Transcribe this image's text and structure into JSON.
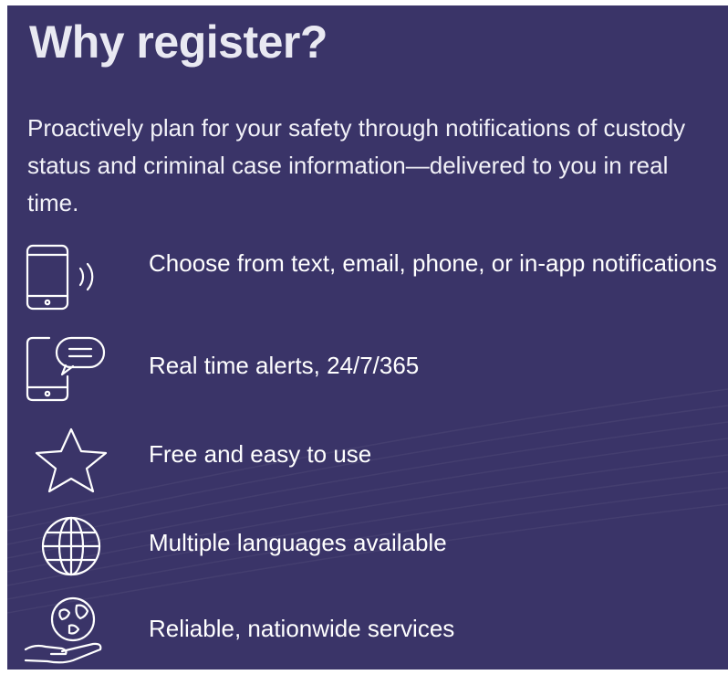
{
  "panel": {
    "title": "Why register?",
    "intro": "Proactively plan for your safety through notifications of custody status and criminal case information—delivered to you in real time.",
    "background_color": "#3a3468",
    "text_color": "#ffffff"
  },
  "features": [
    {
      "icon": "mobile-phone-signal-icon",
      "label": "Choose from text, email, phone, or in-app notifications"
    },
    {
      "icon": "phone-chat-bubble-icon",
      "label": "Real time alerts, 24/7/365"
    },
    {
      "icon": "star-icon",
      "label": "Free and easy to use"
    },
    {
      "icon": "globe-icon",
      "label": "Multiple languages available"
    },
    {
      "icon": "globe-in-hand-icon",
      "label": "Reliable, nationwide services"
    }
  ]
}
